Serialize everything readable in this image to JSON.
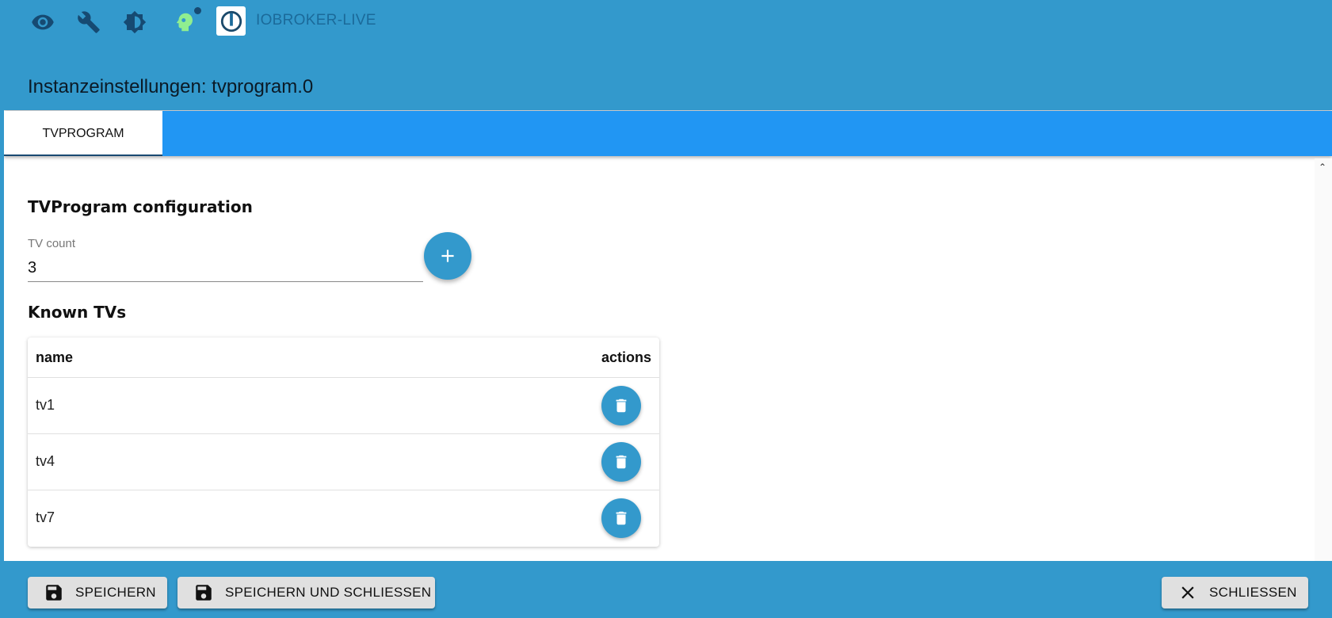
{
  "topbar": {
    "icons": [
      "eye-icon",
      "wrench-icon",
      "brightness-icon",
      "expert-mode-icon"
    ],
    "brand": "IOBROKER-LIVE"
  },
  "dialog": {
    "title": "Instanzeinstellungen: tvprogram.0",
    "tabs": [
      {
        "label": "TVPROGRAM",
        "active": true
      }
    ]
  },
  "config": {
    "heading": "TVProgram configuration",
    "tv_count_label": "TV count",
    "tv_count_value": "3",
    "add_button_icon": "plus-icon",
    "known_heading": "Known TVs"
  },
  "table": {
    "columns": [
      "name",
      "actions"
    ],
    "rows": [
      {
        "name": "tv1",
        "action_icon": "trash-icon"
      },
      {
        "name": "tv4",
        "action_icon": "trash-icon"
      },
      {
        "name": "tv7",
        "action_icon": "trash-icon"
      }
    ]
  },
  "footer": {
    "save": "SPEICHERN",
    "save_close": "SPEICHERN UND SCHLIESSEN",
    "close": "SCHLIESSEN"
  },
  "colors": {
    "primary": "#3399cc",
    "tabbar": "#2196f3",
    "icon_dark": "#164a72",
    "expert_icon": "#90ee90"
  }
}
